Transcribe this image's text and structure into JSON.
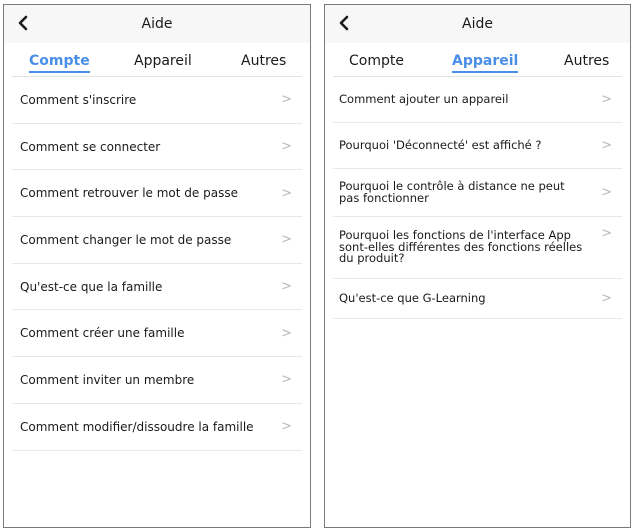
{
  "colors": {
    "accent": "#4a8fe7",
    "chevron": "#b8b8b8",
    "header_bg": "#f7f7f7",
    "text": "#1a1a1a"
  },
  "left_screen": {
    "header": {
      "title": "Aide",
      "back_icon": "chevron-left-icon"
    },
    "tabs": [
      {
        "label": "Compte",
        "active": true
      },
      {
        "label": "Appareil",
        "active": false
      },
      {
        "label": "Autres",
        "active": false
      }
    ],
    "items": [
      {
        "label": "Comment s'inscrire",
        "chevron": ">"
      },
      {
        "label": "Comment se connecter",
        "chevron": ">"
      },
      {
        "label": "Comment retrouver le mot de passe",
        "chevron": ">"
      },
      {
        "label": "Comment changer le mot de passe",
        "chevron": ">"
      },
      {
        "label": "Qu'est-ce que la famille",
        "chevron": ">"
      },
      {
        "label": "Comment créer une famille",
        "chevron": ">"
      },
      {
        "label": "Comment inviter un membre",
        "chevron": ">"
      },
      {
        "label": "Comment modifier/dissoudre la famille",
        "chevron": ">"
      }
    ]
  },
  "right_screen": {
    "header": {
      "title": "Aide",
      "back_icon": "chevron-left-icon"
    },
    "tabs": [
      {
        "label": "Compte",
        "active": false
      },
      {
        "label": "Appareil",
        "active": true
      },
      {
        "label": "Autres",
        "active": false
      }
    ],
    "items": [
      {
        "label": "Comment ajouter un appareil",
        "chevron": ">"
      },
      {
        "label": "Pourquoi 'Déconnecté' est affiché ?",
        "chevron": ">"
      },
      {
        "label": "Pourquoi le contrôle à distance ne peut pas fonctionner",
        "chevron": ">"
      },
      {
        "label": "Pourquoi les fonctions de l'interface App sont-elles différentes des fonctions réelles du produit?",
        "chevron": ">"
      },
      {
        "label": "Qu'est-ce que G-Learning",
        "chevron": ">"
      }
    ]
  }
}
